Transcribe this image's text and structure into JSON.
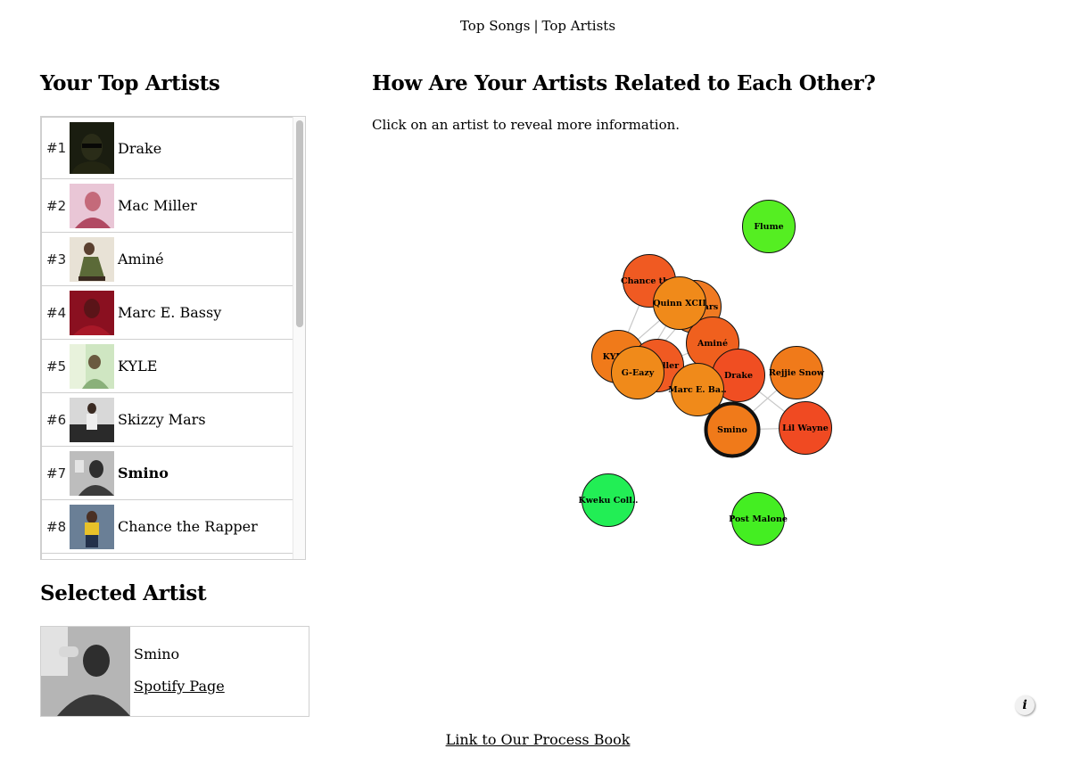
{
  "nav": {
    "top_songs": "Top Songs",
    "separator": "|",
    "top_artists": "Top Artists"
  },
  "artists_panel": {
    "title": "Your Top Artists",
    "items": [
      {
        "rank": "#1",
        "name": "Drake"
      },
      {
        "rank": "#2",
        "name": "Mac Miller"
      },
      {
        "rank": "#3",
        "name": "Aminé"
      },
      {
        "rank": "#4",
        "name": "Marc E. Bassy"
      },
      {
        "rank": "#5",
        "name": "KYLE"
      },
      {
        "rank": "#6",
        "name": "Skizzy Mars"
      },
      {
        "rank": "#7",
        "name": "Smino"
      },
      {
        "rank": "#8",
        "name": "Chance the Rapper"
      }
    ]
  },
  "network_panel": {
    "title": "How Are Your Artists Related to Each Other?",
    "hint": "Click on an artist to reveal more information.",
    "nodes": [
      {
        "label": "Flume",
        "color": "#55ee22"
      },
      {
        "label": "Chance the Rapper",
        "display": "Chance th",
        "color": "#f05a22"
      },
      {
        "label": "Skizzy Mars",
        "display": "ars",
        "color": "#f07a22"
      },
      {
        "label": "Quinn XCII",
        "display": "Quinn XCII",
        "color": "#f08a1a"
      },
      {
        "label": "Aminé",
        "display": "Aminé",
        "color": "#f0601e"
      },
      {
        "label": "KYLE",
        "display": "KYLE",
        "color": "#f07a1a"
      },
      {
        "label": "Mac Miller",
        "display": "ller",
        "color": "#f05a22"
      },
      {
        "label": "G-Eazy",
        "display": "G-Eazy",
        "color": "#f08a1a"
      },
      {
        "label": "Drake",
        "display": "Drake",
        "color": "#f04e22"
      },
      {
        "label": "Marc E. Bassy",
        "display": "Marc E. Ba..",
        "color": "#f08a1a"
      },
      {
        "label": "Rejjie Snow",
        "display": "Rejjie Snow",
        "color": "#f07a1a"
      },
      {
        "label": "Smino",
        "display": "Smino",
        "color": "#f07a1a"
      },
      {
        "label": "Lil Wayne",
        "display": "Lil Wayne",
        "color": "#f04a22"
      },
      {
        "label": "Kweku Collins",
        "display": "Kweku Coll..",
        "color": "#22ee55"
      },
      {
        "label": "Post Malone",
        "display": "Post Malone",
        "color": "#44ee22"
      }
    ]
  },
  "selected_panel": {
    "title": "Selected Artist",
    "name": "Smino",
    "link": "Spotify Page"
  },
  "footer": {
    "process_link": "Link to Our Process Book",
    "info_icon": "i"
  }
}
